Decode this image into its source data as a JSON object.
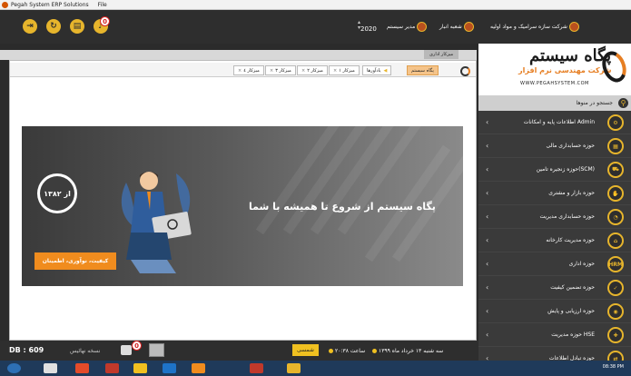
{
  "window": {
    "title": "Pegah System ERP Solutions",
    "menu": "File"
  },
  "topbar": {
    "notification_count": "0",
    "year": "2020",
    "company_items": [
      {
        "label": "مدیر سیستم"
      },
      {
        "label": "شعبه انبار"
      },
      {
        "label": "شرکت سازه سرامیک و مواد اولیه"
      }
    ]
  },
  "logo": {
    "title": "پگاه سیستم",
    "subtitle": "شرکت مهندسی نرم افزار",
    "url": "WWW.PEGAHSYSTEM.COM"
  },
  "sidebar": {
    "search_placeholder": "جستجو در منوها",
    "items": [
      {
        "label": "اطلاعات پایه و امکانات Admin",
        "icon": "gear-icon"
      },
      {
        "label": "حوزه حسابداری مالی",
        "icon": "calculator-icon"
      },
      {
        "label": "حوزه زنجیره تامین(SCM)",
        "icon": "truck-icon"
      },
      {
        "label": "حوزه بازار و مشتری",
        "icon": "handshake-icon"
      },
      {
        "label": "حوزه حسابداری مدیریت",
        "icon": "chart-icon"
      },
      {
        "label": "حوزه مدیریت کارخانه",
        "icon": "factory-icon"
      },
      {
        "label": "حوزه اداری",
        "icon": "hrm-icon",
        "badge": "HRM"
      },
      {
        "label": "حوزه تضمین کیفیت",
        "icon": "quality-icon"
      },
      {
        "label": "حوزه ارزیابی و پایش",
        "icon": "monitor-icon"
      },
      {
        "label": "حوزه مدیریت HSE",
        "icon": "hse-icon"
      },
      {
        "label": "حوزه تبادل اطلاعات",
        "icon": "exchange-icon"
      }
    ]
  },
  "main": {
    "window_tab": "میزکار اداری",
    "tabs": [
      {
        "label": "پگاه سیستم",
        "kind": "home"
      },
      {
        "label": "یادآورها",
        "kind": "fav"
      },
      {
        "label": "میزکار ۱"
      },
      {
        "label": "میزکار ۲"
      },
      {
        "label": "میزکار ۳"
      },
      {
        "label": "میزکار ٤"
      }
    ],
    "banner": {
      "headline": "پگاه سیستم از شروع تا همیشه با شما",
      "since": "از ۱۳۸۲",
      "tagline": "کیفیت، نوآوری، اطمینان"
    }
  },
  "statusbar": {
    "db": "DB : 609",
    "version_label": "نسخه نهائیس",
    "notification_count": "0",
    "calendar_button": "شمسی",
    "time": "ساعت ٢٠:٣٨",
    "date": "سه شنبه ۱۳ خرداد ماه ۱۳۹۹"
  },
  "taskbar": {
    "time": "08:38 PM"
  },
  "colors": {
    "accent": "#e7b52c",
    "orange": "#f08c1e",
    "dark": "#2e2e2e"
  }
}
